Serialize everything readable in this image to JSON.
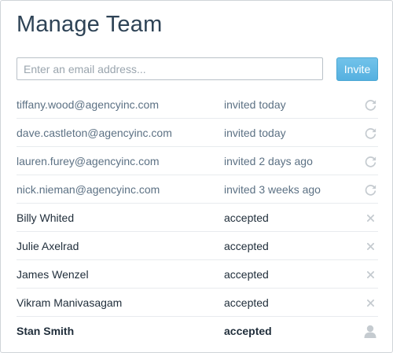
{
  "title": "Manage Team",
  "invite_form": {
    "placeholder": "Enter an email address...",
    "value": "",
    "button_label": "Invite"
  },
  "members": [
    {
      "name": "tiffany.wood@agencyinc.com",
      "status": "invited today",
      "state": "invited",
      "action_icon": "resend-icon"
    },
    {
      "name": "dave.castleton@agencyinc.com",
      "status": "invited today",
      "state": "invited",
      "action_icon": "resend-icon"
    },
    {
      "name": "lauren.furey@agencyinc.com",
      "status": "invited 2 days ago",
      "state": "invited",
      "action_icon": "resend-icon"
    },
    {
      "name": "nick.nieman@agencyinc.com",
      "status": "invited 3 weeks ago",
      "state": "invited",
      "action_icon": "resend-icon"
    },
    {
      "name": "Billy Whited",
      "status": "accepted",
      "state": "member",
      "action_icon": "remove-icon"
    },
    {
      "name": "Julie Axelrad",
      "status": "accepted",
      "state": "member",
      "action_icon": "remove-icon"
    },
    {
      "name": "James Wenzel",
      "status": "accepted",
      "state": "member",
      "action_icon": "remove-icon"
    },
    {
      "name": "Vikram Manivasagam",
      "status": "accepted",
      "state": "member",
      "action_icon": "remove-icon"
    },
    {
      "name": "Stan Smith",
      "status": "accepted",
      "state": "self",
      "action_icon": "user-icon"
    }
  ],
  "colors": {
    "title": "#2e4356",
    "accent": "#5ab4e2",
    "invited_text": "#5c7184",
    "member_text": "#1f2d3a",
    "icon": "#c5cbd0"
  }
}
